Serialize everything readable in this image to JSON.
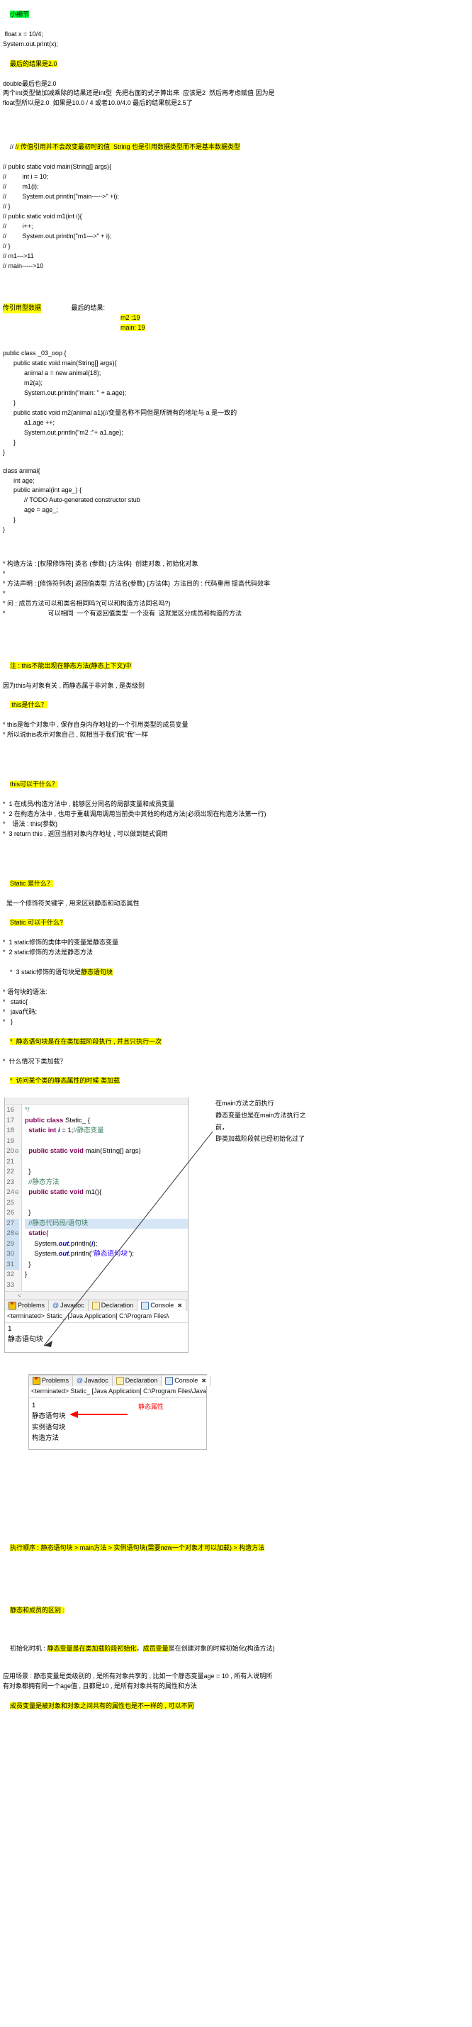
{
  "section_details": {
    "title": "小细节",
    "lines": [
      " float x = 10/4;",
      "System.out.print(x);",
      "最后的结果是2.0",
      "double最后也是2.0",
      "两个int类型做加减乘除的结果还是int型  先把右面的式子算出来  应该是2  然后再考虑赋值 因为是",
      "float型所以是2.0  如果是10.0 / 4 或者10.0/4.0 最后的结果就是2.5了"
    ],
    "highlight_result": "最后的结果是2.0"
  },
  "section_passvalue": {
    "comment_header": "// 传值引用并不会改变最初时的值  String 也是引用数据类型而不是基本数据类型",
    "code": [
      "// public static void main(String[] args){",
      "//         int i = 10;",
      "//         m1(i);",
      "//         System.out.println(\"main----->\" +i);",
      "// }",
      "// public static void m1(int i){",
      "//         i++;",
      "//         System.out.println(\"m1--->\" + i);",
      "// }",
      "// m1--->11",
      "// main----->10"
    ]
  },
  "section_passref": {
    "label": "传引用型数据",
    "result_label": "最后的结果:",
    "result_lines": [
      "m2 :19",
      "main: 19"
    ],
    "code": [
      "public class _03_oop {",
      "      public static void main(String[] args){",
      "            animal a = new animal(18);",
      "            m2(a);",
      "            System.out.println(\"main: \" + a.age);",
      "      }",
      "      public static void m2(animal a1){//变量名称不同但是所拥有的地址与 a 是一致的",
      "            a1.age ++;",
      "            System.out.println(\"m2 :\"+ a1.age);",
      "      }",
      "}"
    ],
    "code2": [
      "class animal{",
      "      int age;",
      "      public animal(int age_) {",
      "            // TODO Auto-generated constructor stub",
      "            age = age_;",
      "      }",
      "}"
    ]
  },
  "section_methods": {
    "lines": [
      "* 构造方法 : [权限修饰符] 类名 (参数) {方法体}  创建对象 , 初始化对象",
      "*",
      "* 方法声明 : [修饰符列表] 返回值类型 方法名(参数) {方法体}  方法目的 : 代码重用 提高代码效率",
      "*",
      "* 问 : 成员方法可以和类名相同吗?(可以和构造方法同名吗?)",
      "*                        可以相同  一个有返回值类型 一个没有  这就是区分成员和构造的方法"
    ]
  },
  "section_this": {
    "note": "注 : this不能出现在静态方法(静态上下文)中",
    "note_reason": "因为this与对象有关 , 而静态属于非对象 , 是类级别",
    "q1": " this是什么？",
    "a1": [
      "* this是每个对象中 , 保存自身内存地址的一个引用类型的成员变量",
      "* 所以说this表示对象自己 , 就相当于我们说\"我\"一样"
    ],
    "q2": "this可以干什么？",
    "a2": [
      "*  1 在成员/构造方法中 , 能够区分同名的局部变量和成员变量",
      "*  2 在构造方法中 , 也用于重载调用调用当前类中其他的构造方法(必须出现在构造方法第一行)",
      "*    语法 : this(参数)",
      "*  3 return this , 返回当前对象内存地址 , 可以做到链式调用"
    ]
  },
  "section_static": {
    "q1": "Static 是什么？",
    "a1": "  是一个修饰符关键字 , 用来区别静态和动态属性",
    "q2": "Static 可以干什么?",
    "a2_1": "*  1 static修饰的类体中的变量是静态变量",
    "a2_2": "*  2 static修饰的方法是静态方法",
    "a2_3_pre": "*  3 static修饰的语句块是",
    "a2_3_hl": "静态语句块",
    "a2_4": "* 语句块的语法:",
    "a2_5": "*   static{",
    "a2_6": "*   java代码;",
    "a2_7": "*   }",
    "a2_8": "*  静态语句块是在在类加载阶段执行 , 并且只执行一次",
    "a2_9": "*  什么情况下类加载？",
    "a2_10": "*  访问某个类的静态属性的时候 类加载"
  },
  "editor": {
    "line_numbers": [
      "16",
      "17",
      "18",
      "19",
      "20",
      "21",
      "22",
      "23",
      "24",
      "25",
      "26",
      "27",
      "28",
      "29",
      "30",
      "31",
      "32",
      "33"
    ],
    "fold_lines": [
      "20",
      "24",
      "28"
    ],
    "marked_lines": [
      "27",
      "28",
      "29",
      "30",
      "31"
    ],
    "selected_line": "27",
    "code": [
      {
        "n": "16",
        "parts": [
          {
            "t": "*/",
            "c": "cmt"
          }
        ]
      },
      {
        "n": "17",
        "parts": [
          {
            "t": "public class ",
            "c": "kw"
          },
          {
            "t": "Static_ {",
            "c": ""
          }
        ]
      },
      {
        "n": "18",
        "parts": [
          {
            "t": "  ",
            "c": ""
          },
          {
            "t": "static int ",
            "c": "kw"
          },
          {
            "t": "i",
            "c": "fld"
          },
          {
            "t": " = 1;",
            "c": ""
          },
          {
            "t": "//静态变量",
            "c": "cmt"
          }
        ]
      },
      {
        "n": "19",
        "parts": [
          {
            "t": "",
            "c": ""
          }
        ]
      },
      {
        "n": "20",
        "parts": [
          {
            "t": "  ",
            "c": ""
          },
          {
            "t": "public static void ",
            "c": "kw"
          },
          {
            "t": "main(String[] args)",
            "c": ""
          }
        ]
      },
      {
        "n": "21",
        "parts": [
          {
            "t": "",
            "c": ""
          }
        ]
      },
      {
        "n": "22",
        "parts": [
          {
            "t": "  }",
            "c": ""
          }
        ]
      },
      {
        "n": "23",
        "parts": [
          {
            "t": "  ",
            "c": ""
          },
          {
            "t": "//静态方法",
            "c": "cmt"
          }
        ]
      },
      {
        "n": "24",
        "parts": [
          {
            "t": "  ",
            "c": ""
          },
          {
            "t": "public static void ",
            "c": "kw"
          },
          {
            "t": "m1(){",
            "c": ""
          }
        ]
      },
      {
        "n": "25",
        "parts": [
          {
            "t": "",
            "c": ""
          }
        ]
      },
      {
        "n": "26",
        "parts": [
          {
            "t": "  }",
            "c": ""
          }
        ]
      },
      {
        "n": "27",
        "parts": [
          {
            "t": "  ",
            "c": ""
          },
          {
            "t": "//静态代码段/语句块",
            "c": "cmt"
          }
        ]
      },
      {
        "n": "28",
        "parts": [
          {
            "t": "  ",
            "c": ""
          },
          {
            "t": "static",
            "c": "kw"
          },
          {
            "t": "{",
            "c": ""
          }
        ]
      },
      {
        "n": "29",
        "parts": [
          {
            "t": "     System.",
            "c": ""
          },
          {
            "t": "out",
            "c": "fld"
          },
          {
            "t": ".println(",
            "c": ""
          },
          {
            "t": "i",
            "c": "fld"
          },
          {
            "t": ");",
            "c": ""
          }
        ]
      },
      {
        "n": "30",
        "parts": [
          {
            "t": "     System.",
            "c": ""
          },
          {
            "t": "out",
            "c": "fld"
          },
          {
            "t": ".println(",
            "c": ""
          },
          {
            "t": "\"静态语句块\"",
            "c": "str"
          },
          {
            "t": ");",
            "c": ""
          }
        ]
      },
      {
        "n": "31",
        "parts": [
          {
            "t": "  }",
            "c": ""
          }
        ]
      },
      {
        "n": "32",
        "parts": [
          {
            "t": "}",
            "c": ""
          }
        ]
      },
      {
        "n": "33",
        "parts": [
          {
            "t": "",
            "c": ""
          }
        ]
      }
    ],
    "hscroll_mark": "<"
  },
  "annotation_right": [
    "在main方法之前执行",
    "静态变量也是在main方法执行之",
    "前，",
    "即类加载阶段就已经初始化过了"
  ],
  "console_panel": {
    "tabs": [
      {
        "label": "Problems",
        "icon": "problems-icon",
        "active": false
      },
      {
        "label": "Javadoc",
        "icon": "javadoc-icon",
        "active": false
      },
      {
        "label": "Declaration",
        "icon": "declaration-icon",
        "active": false
      },
      {
        "label": "Console",
        "icon": "console-icon",
        "active": true,
        "close": "✖"
      }
    ],
    "terminated_line": "<terminated> Static_ [Java Application] C:\\Program Files\\",
    "output": [
      "1",
      "静态语句块"
    ]
  },
  "console_panel2": {
    "tabs": [
      {
        "label": "Problems",
        "icon": "problems-icon",
        "active": false
      },
      {
        "label": "Javadoc",
        "icon": "javadoc-icon",
        "active": false
      },
      {
        "label": "Declaration",
        "icon": "declaration-icon",
        "active": false
      },
      {
        "label": "Console",
        "icon": "console-icon",
        "active": true,
        "close": "✖"
      }
    ],
    "terminated_line": "<terminated> Static_ [Java Application] C:\\Program Files\\Java\\j",
    "output": [
      "1",
      "静态语句块",
      "实例语句块",
      "构造方法"
    ],
    "annotation": "静态属性",
    "annotation_color": "#ff0000"
  },
  "section_order": {
    "text": "执行顺序 : 静态语句块 > main方法 > 实例语句块(需要new一个对象才可以加载) > 构造方法"
  },
  "section_diff": {
    "title": "静态和成员的区别 :",
    "line1_pre": "初始化时机 : ",
    "line1_hl1": "静态变量是在类加载阶段初始化",
    "line1_mid": "，",
    "line1_hl2": "成员变量",
    "line1_post": "是在创建对象的时候初始化(构造方法)",
    "line2": "应用场景 : 静态变量是类级别的 , 是所有对象共享的 , 比如一个静态变量age = 10 , 所有人说明所",
    "line2b": "有对象都拥有同一个age值 , 且都是10 , 是所有对象共有的属性和方法",
    "line3_hl": "成员变量是被对象和对象之间共有的属性也是不一样的 , 可以不同"
  },
  "colors": {
    "highlight_yellow": "#ffff00",
    "highlight_green": "#00ff3c",
    "red": "#ff0000",
    "keyword": "#7f0055",
    "comment": "#3f7f5f",
    "string": "#2a00ff",
    "field": "#0000c0"
  }
}
